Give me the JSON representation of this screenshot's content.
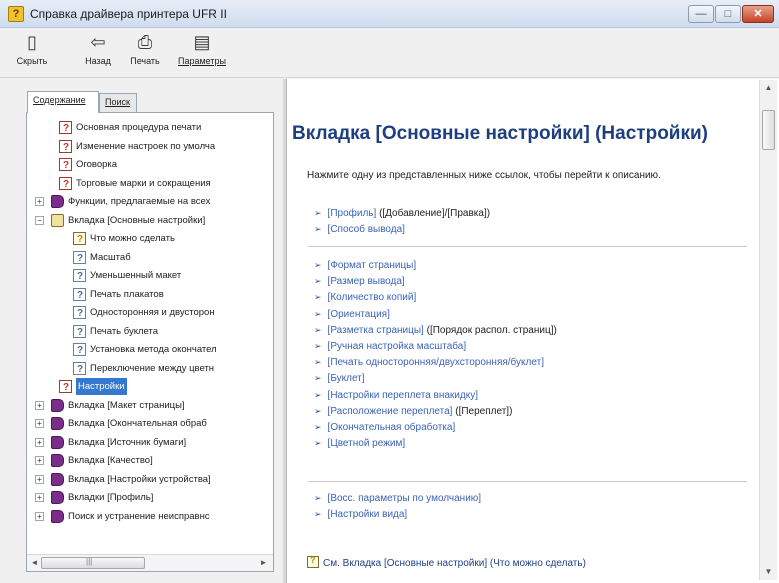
{
  "window": {
    "title": "Справка драйвера принтера UFR II",
    "minimize_glyph": "—",
    "maximize_glyph": "□",
    "close_glyph": "✕"
  },
  "toolbar": {
    "hide": {
      "label": "Скрыть",
      "icon": "hide-pane-icon",
      "glyph": "▯"
    },
    "back": {
      "label": "Назад",
      "icon": "back-arrow-icon",
      "glyph": "⇦"
    },
    "print": {
      "label": "Печать",
      "icon": "printer-icon",
      "glyph": "⎙"
    },
    "options": {
      "label": "Параметры",
      "icon": "options-icon",
      "glyph": "▤"
    }
  },
  "nav_tabs": {
    "contents": "Содержание",
    "search": "Поиск"
  },
  "tree": [
    {
      "label": "Основная процедура печати",
      "icon": "page-q",
      "exp": ""
    },
    {
      "label": "Изменение настроек по умолча",
      "icon": "page-q",
      "exp": ""
    },
    {
      "label": "Оговорка",
      "icon": "page-q",
      "exp": ""
    },
    {
      "label": "Торговые марки и сокращения",
      "icon": "page-q",
      "exp": ""
    },
    {
      "label": "Функции, предлагаемые на всех",
      "icon": "book",
      "exp": "+"
    },
    {
      "label": "Вкладка [Основные настройки]",
      "icon": "book-open",
      "exp": "−"
    },
    {
      "label": "Что можно сделать",
      "icon": "page-y",
      "exp": ""
    },
    {
      "label": "Масштаб",
      "icon": "page-b",
      "exp": ""
    },
    {
      "label": "Уменьшенный макет",
      "icon": "page-b",
      "exp": ""
    },
    {
      "label": "Печать плакатов",
      "icon": "page-b",
      "exp": ""
    },
    {
      "label": "Односторонняя и двусторон",
      "icon": "page-b",
      "exp": ""
    },
    {
      "label": "Печать буклета",
      "icon": "page-b",
      "exp": ""
    },
    {
      "label": "Установка метода окончател",
      "icon": "page-b",
      "exp": ""
    },
    {
      "label": "Переключение между цветн",
      "icon": "page-b",
      "exp": ""
    },
    {
      "label": "Настройки",
      "icon": "page-q",
      "exp": "",
      "selected": true
    },
    {
      "label": "Вкладка [Макет страницы]",
      "icon": "book",
      "exp": "+"
    },
    {
      "label": "Вкладка [Окончательная обраб",
      "icon": "book",
      "exp": "+"
    },
    {
      "label": "Вкладка [Источник бумаги]",
      "icon": "book",
      "exp": "+"
    },
    {
      "label": "Вкладка [Качество]",
      "icon": "book",
      "exp": "+"
    },
    {
      "label": "Вкладка [Настройки устройства]",
      "icon": "book",
      "exp": "+"
    },
    {
      "label": "Вкладки [Профиль]",
      "icon": "book",
      "exp": "+"
    },
    {
      "label": "Поиск и устранение неисправнс",
      "icon": "book",
      "exp": "+"
    }
  ],
  "tree_scrollbar": {
    "left_arrow": "◄",
    "right_arrow": "►",
    "grip": "|||"
  },
  "content_scrollbar": {
    "up_arrow": "▲",
    "down_arrow": "▼"
  },
  "content": {
    "heading": "Вкладка [Основные настройки] (Настройки)",
    "intro": "Нажмите одну из представленных ниже ссылок, чтобы перейти к описанию.",
    "group1": [
      {
        "link": "[Профиль]",
        "extra": "([Добавление]/[Правка])"
      },
      {
        "link": "[Способ вывода]",
        "extra": ""
      }
    ],
    "group2": [
      {
        "link": "[Формат страницы]",
        "extra": ""
      },
      {
        "link": "[Размер вывода]",
        "extra": ""
      },
      {
        "link": "[Количество копий]",
        "extra": ""
      },
      {
        "link": "[Ориентация]",
        "extra": ""
      },
      {
        "link": "[Разметка страницы]",
        "extra": "([Порядок распол. страниц])"
      },
      {
        "link": "[Ручная настройка масштаба]",
        "extra": ""
      },
      {
        "link": "[Печать односторонняя/двухсторонняя/буклет]",
        "extra": ""
      },
      {
        "link": "[Буклет]",
        "extra": ""
      },
      {
        "link": "[Настройки переплета внакидку]",
        "extra": ""
      },
      {
        "link": "[Расположение переплета]",
        "extra": "([Переплет])"
      },
      {
        "link": "[Окончательная обработка]",
        "extra": ""
      },
      {
        "link": "[Цветной режим]",
        "extra": ""
      }
    ],
    "group3": [
      {
        "link": "[Восс. параметры по умолчанию]",
        "extra": ""
      },
      {
        "link": "[Настройки вида]",
        "extra": ""
      }
    ],
    "see_also": "См. Вкладка [Основные настройки] (Что можно сделать)",
    "bullet": "➢"
  }
}
